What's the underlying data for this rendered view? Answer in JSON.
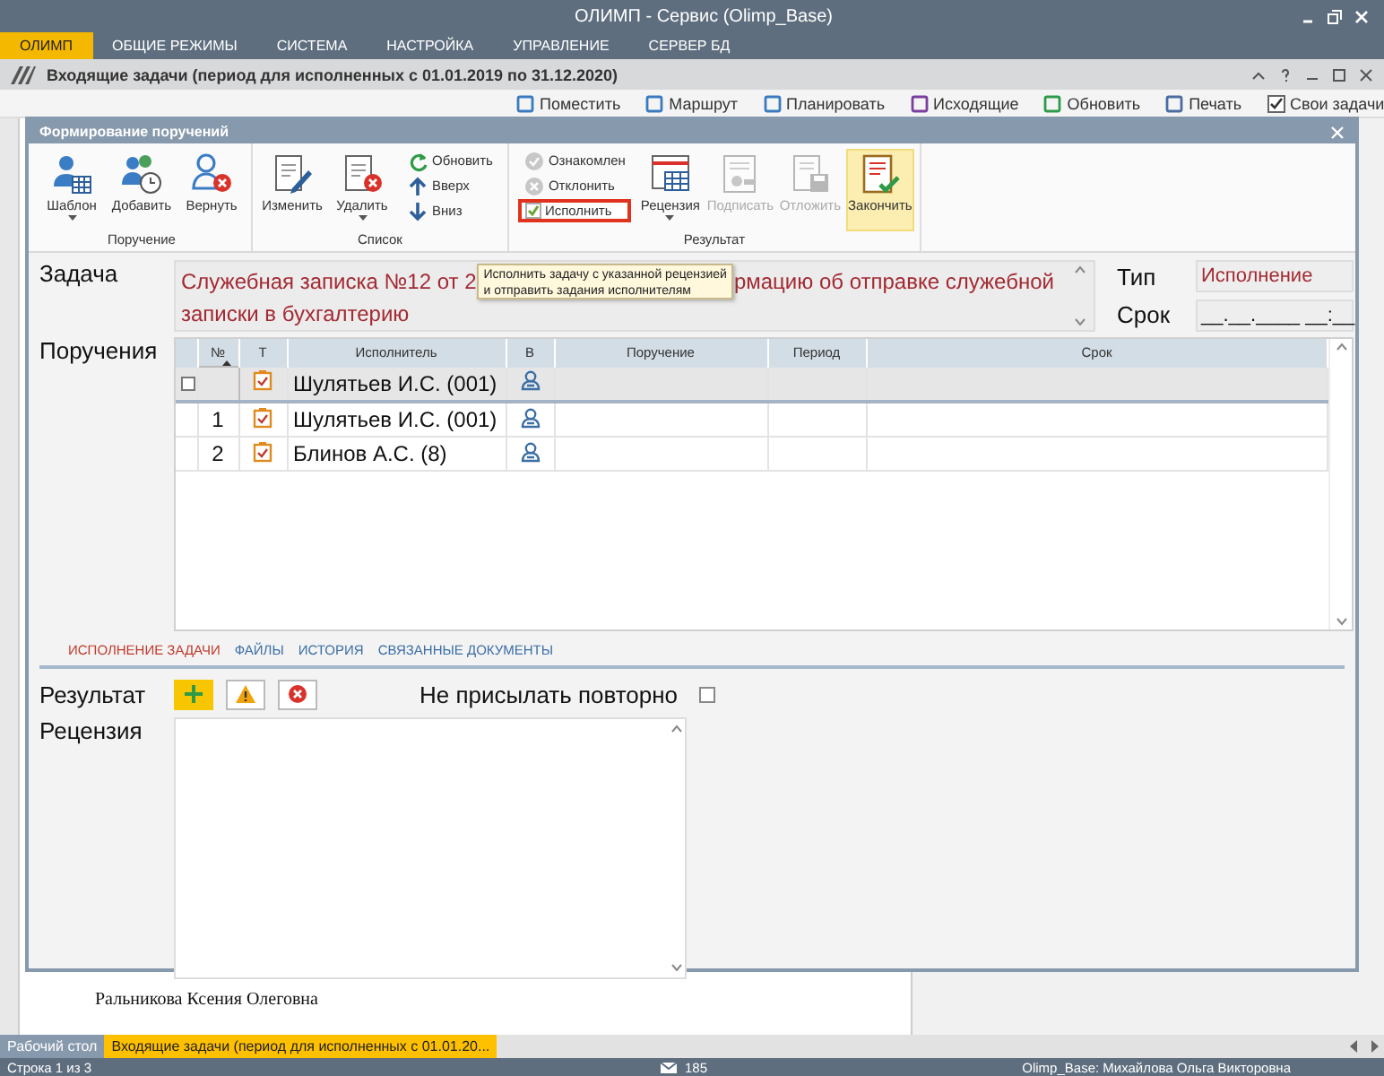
{
  "window": {
    "title": "ОЛИМП - Сервис (Olimp_Base)"
  },
  "menu": [
    {
      "label": "ОЛИМП",
      "selected": true
    },
    {
      "label": "ОБЩИЕ РЕЖИМЫ",
      "selected": false
    },
    {
      "label": "СИСТЕМА",
      "selected": false
    },
    {
      "label": "НАСТРОЙКА",
      "selected": false
    },
    {
      "label": "УПРАВЛЕНИЕ",
      "selected": false
    },
    {
      "label": "СЕРВЕР БД",
      "selected": false
    }
  ],
  "document": {
    "title": "Входящие задачи (период для исполненных с 01.01.2019 по 31.12.2020)",
    "toolbar": [
      "Поместить",
      "Маршрут",
      "Планировать",
      "Исходящие",
      "Обновить",
      "Печать"
    ],
    "own_tasks": {
      "label": "Свои задачи",
      "checked": true
    },
    "signer": "Ральникова Ксения Олеговна"
  },
  "dialog": {
    "title": "Формирование поручений",
    "ribbon": [
      {
        "label": "Поручение",
        "buttons": [
          {
            "label": "Шаблон",
            "kind": "large",
            "dropdown": true,
            "disabled": false,
            "hovered": false
          },
          {
            "label": "Добавить",
            "kind": "large",
            "dropdown": false,
            "disabled": false,
            "hovered": false
          },
          {
            "label": "Вернуть",
            "kind": "large",
            "dropdown": false,
            "disabled": false,
            "hovered": false
          }
        ]
      },
      {
        "label": "Список",
        "buttons": [
          {
            "label": "Изменить",
            "kind": "large",
            "dropdown": false,
            "disabled": false,
            "hovered": false
          },
          {
            "label": "Удалить",
            "kind": "large",
            "dropdown": true,
            "disabled": false,
            "hovered": false
          },
          {
            "label": "Обновить",
            "kind": "small",
            "dropdown": false,
            "disabled": false,
            "hovered": false
          },
          {
            "label": "Вверх",
            "kind": "small",
            "dropdown": false,
            "disabled": false,
            "hovered": false
          },
          {
            "label": "Вниз",
            "kind": "small",
            "dropdown": false,
            "disabled": false,
            "hovered": false
          }
        ]
      },
      {
        "label": "Результат",
        "buttons": [
          {
            "label": "Ознакомлен",
            "kind": "small",
            "dropdown": false,
            "disabled": true,
            "hovered": false
          },
          {
            "label": "Отклонить",
            "kind": "small",
            "dropdown": false,
            "disabled": true,
            "hovered": false
          },
          {
            "label": "Исполнить",
            "kind": "check",
            "checked": true,
            "outlined": true,
            "dropdown": false,
            "disabled": false,
            "hovered": false
          },
          {
            "label": "Рецензия",
            "kind": "large",
            "dropdown": true,
            "disabled": false,
            "hovered": false
          },
          {
            "label": "Подписать",
            "kind": "large",
            "dropdown": false,
            "disabled": true,
            "hovered": false
          },
          {
            "label": "Отложить",
            "kind": "large",
            "dropdown": false,
            "disabled": true,
            "hovered": false
          },
          {
            "label": "Закончить",
            "kind": "large",
            "dropdown": false,
            "disabled": false,
            "hovered": true
          }
        ]
      }
    ],
    "tooltip": {
      "lines": [
        "Исполнить задачу с указанной рецензией",
        "и отправить задания исполнителям"
      ]
    },
    "task": {
      "label": "Задача",
      "text_start": "Служебная записка №12 от 2",
      "text_end": "рмацию об отправке служебной",
      "text_line2": "записки в бухгалтерию"
    },
    "type": {
      "label": "Тип",
      "value": "Исполнение"
    },
    "deadline": {
      "label": "Срок",
      "value": "__.__.____ __:__"
    },
    "assignments": {
      "label": "Поручения",
      "columns": [
        {
          "label": "№",
          "sorted": true
        },
        {
          "label": "Т",
          "sorted": false
        },
        {
          "label": "Исполнитель",
          "sorted": false
        },
        {
          "label": "В",
          "sorted": false
        },
        {
          "label": "Поручение",
          "sorted": false
        },
        {
          "label": "Период",
          "sorted": false
        },
        {
          "label": "Срок",
          "sorted": false
        }
      ],
      "rows": [
        {
          "kind": "new",
          "number": "",
          "executor": "Шулятьев И.С. (001)",
          "selected": true
        },
        {
          "kind": "item",
          "number": "1",
          "executor": "Шулятьев И.С. (001)",
          "selected": false
        },
        {
          "kind": "item",
          "number": "2",
          "executor": "Блинов А.С. (8)",
          "selected": false
        }
      ]
    },
    "tabs": [
      {
        "label": "ИСПОЛНЕНИЕ ЗАДАЧИ",
        "selected": true
      },
      {
        "label": "ФАЙЛЫ",
        "selected": false
      },
      {
        "label": "ИСТОРИЯ",
        "selected": false
      },
      {
        "label": "СВЯЗАННЫЕ ДОКУМЕНТЫ",
        "selected": false
      }
    ],
    "result": {
      "label": "Результат",
      "buttons": [
        {
          "kind": "add",
          "selected": true
        },
        {
          "kind": "warning",
          "selected": false
        },
        {
          "kind": "reject",
          "selected": false
        }
      ],
      "no_repeat": {
        "label": "Не присылать повторно",
        "checked": false
      }
    },
    "review": {
      "label": "Рецензия"
    }
  },
  "taskbar": [
    {
      "label": "Рабочий стол",
      "selected": false
    },
    {
      "label": "Входящие задачи (период для исполненных с 01.01.20...",
      "selected": true
    }
  ],
  "status": {
    "rows": "Строка 1 из 3",
    "mail_count": "185",
    "user": "Olimp_Base: Михайлова Ольга Викторовна"
  }
}
